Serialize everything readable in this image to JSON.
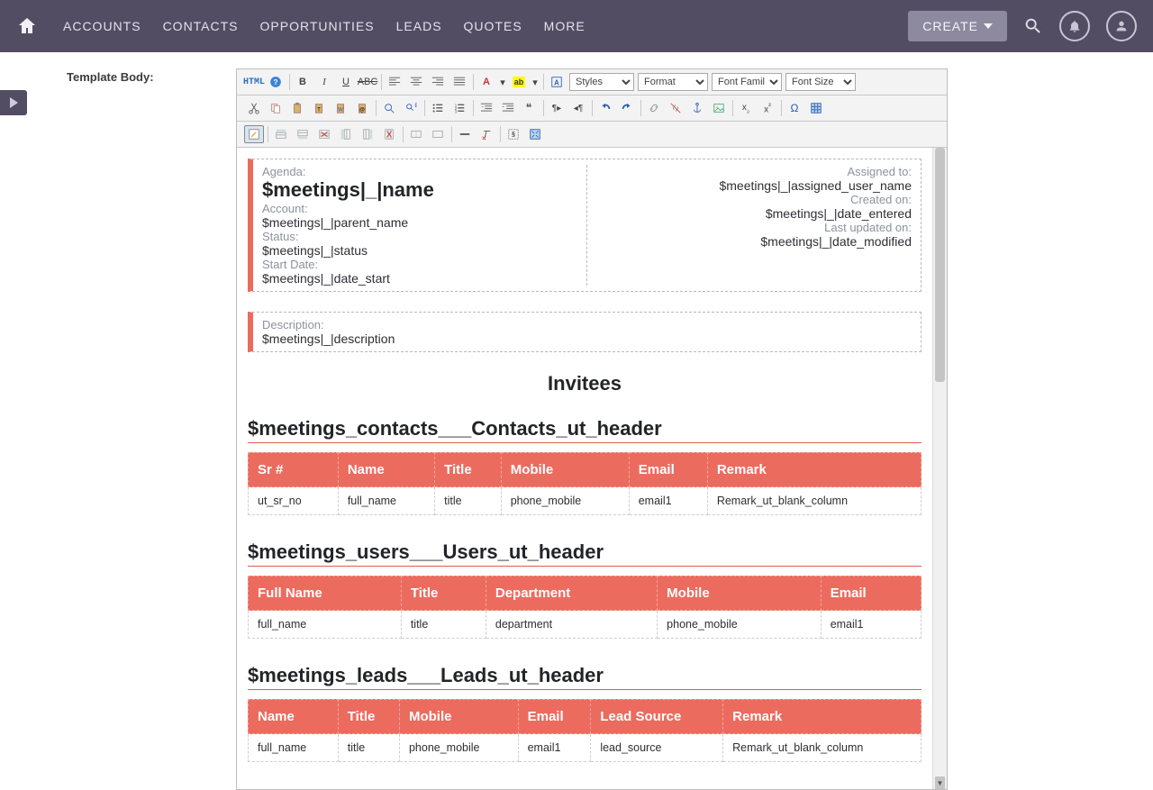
{
  "nav": {
    "items": [
      "ACCOUNTS",
      "CONTACTS",
      "OPPORTUNITIES",
      "LEADS",
      "QUOTES",
      "MORE"
    ],
    "create_label": "CREATE"
  },
  "field_label": "Template Body:",
  "toolbar": {
    "html_label": "HTML",
    "styles_label": "Styles",
    "format_label": "Format",
    "fontfamily_label": "Font Family",
    "fontsize_label": "Font Size"
  },
  "meeting_box": {
    "agenda_label": "Agenda:",
    "agenda_value": "$meetings|_|name",
    "account_label": "Account:",
    "account_value": "$meetings|_|parent_name",
    "status_label": "Status:",
    "status_value": "$meetings|_|status",
    "startdate_label": "Start Date:",
    "startdate_value": "$meetings|_|date_start",
    "assigned_label": "Assigned to:",
    "assigned_value": "$meetings|_|assigned_user_name",
    "created_label": "Created on:",
    "created_value": "$meetings|_|date_entered",
    "updated_label": "Last updated on:",
    "updated_value": "$meetings|_|date_modified"
  },
  "desc_box": {
    "label": "Description:",
    "value": "$meetings|_|description"
  },
  "invitees_title": "Invitees",
  "contacts": {
    "header": "$meetings_contacts___Contacts_ut_header",
    "cols": [
      "Sr #",
      "Name",
      "Title",
      "Mobile",
      "Email",
      "Remark"
    ],
    "row": [
      "ut_sr_no",
      "full_name",
      "title",
      "phone_mobile",
      "email1",
      "Remark_ut_blank_column"
    ]
  },
  "users": {
    "header": "$meetings_users___Users_ut_header",
    "cols": [
      "Full Name",
      "Title",
      "Department",
      "Mobile",
      "Email"
    ],
    "row": [
      "full_name",
      "title",
      "department",
      "phone_mobile",
      "email1"
    ]
  },
  "leads": {
    "header": "$meetings_leads___Leads_ut_header",
    "cols": [
      "Name",
      "Title",
      "Mobile",
      "Email",
      "Lead Source",
      "Remark"
    ],
    "row": [
      "full_name",
      "title",
      "phone_mobile",
      "email1",
      "lead_source",
      "Remark_ut_blank_column"
    ]
  }
}
